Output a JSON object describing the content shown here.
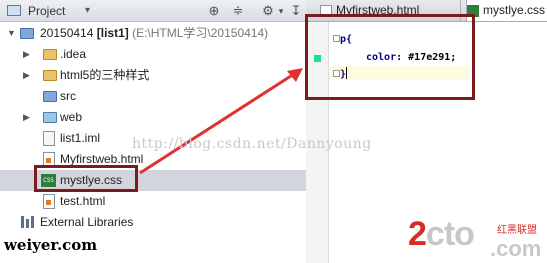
{
  "project_panel": {
    "title": "Project",
    "tree": [
      {
        "label": "20150414",
        "bold": "[list1]",
        "path": "(E:\\HTML学习\\20150414)"
      },
      {
        "label": ".idea"
      },
      {
        "label": "html5的三种样式"
      },
      {
        "label": "src"
      },
      {
        "label": "web"
      },
      {
        "label": "list1.iml"
      },
      {
        "label": "Myfirstweb.html"
      },
      {
        "label": "mystlye.css"
      },
      {
        "label": "test.html"
      },
      {
        "label": "External Libraries"
      }
    ]
  },
  "editor": {
    "tabs": [
      {
        "label": "Myfirstweb.html"
      },
      {
        "label": "mystlye.css"
      }
    ],
    "code": {
      "line1": "p{",
      "prop": "color",
      "value": "#17e291;",
      "line3": "}"
    },
    "swatch_color": "#17e291"
  },
  "watermarks": {
    "blog": "http://blog.csdn.net/Dannyoung",
    "site": "weiyer.com",
    "logo_2": "2",
    "logo_rest": "cto",
    "logo_com": ".com",
    "logo_cn": "红黑联盟"
  },
  "colors": {
    "annotation_red": "#e03030",
    "box": "#7a1b1d"
  }
}
